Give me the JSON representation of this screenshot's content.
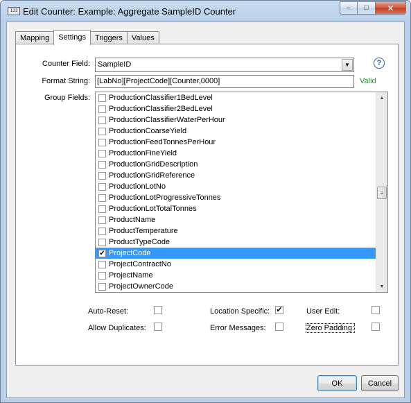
{
  "window": {
    "icon_text": "123",
    "title": "Edit Counter: Example: Aggregate SampleID Counter",
    "controls": {
      "minimize": "–",
      "maximize": "□",
      "close": "✕"
    }
  },
  "tabs": [
    {
      "label": "Mapping"
    },
    {
      "label": "Settings"
    },
    {
      "label": "Triggers"
    },
    {
      "label": "Values"
    }
  ],
  "form": {
    "counter_field_label": "Counter Field:",
    "counter_field_value": "SampleID",
    "help_glyph": "?",
    "format_string_label": "Format String:",
    "format_string_value": "[LabNo][ProjectCode][Counter,0000]",
    "valid_text": "Valid",
    "group_fields_label": "Group Fields:"
  },
  "group_fields": [
    {
      "label": "ProductionClassifier1BedLevel",
      "mark": ""
    },
    {
      "label": "ProductionClassifier2BedLevel",
      "mark": ""
    },
    {
      "label": "ProductionClassifierWaterPerHour",
      "mark": ""
    },
    {
      "label": "ProductionCoarseYield",
      "mark": ""
    },
    {
      "label": "ProductionFeedTonnesPerHour",
      "mark": ""
    },
    {
      "label": "ProductionFineYield",
      "mark": ""
    },
    {
      "label": "ProductionGridDescription",
      "mark": ""
    },
    {
      "label": "ProductionGridReference",
      "mark": ""
    },
    {
      "label": "ProductionLotNo",
      "mark": ""
    },
    {
      "label": "ProductionLotProgressiveTonnes",
      "mark": ""
    },
    {
      "label": "ProductionLotTotalTonnes",
      "mark": ""
    },
    {
      "label": "ProductName",
      "mark": ""
    },
    {
      "label": "ProductTemperature",
      "mark": ""
    },
    {
      "label": "ProductTypeCode",
      "mark": ""
    },
    {
      "label": "ProjectCode",
      "mark": "✔"
    },
    {
      "label": "ProjectContractNo",
      "mark": ""
    },
    {
      "label": "ProjectName",
      "mark": ""
    },
    {
      "label": "ProjectOwnerCode",
      "mark": ""
    }
  ],
  "options": {
    "auto_reset": {
      "label": "Auto-Reset:",
      "mark": ""
    },
    "allow_duplicates": {
      "label": "Allow Duplicates:",
      "mark": ""
    },
    "location_specific": {
      "label": "Location Specific:",
      "mark": "✔"
    },
    "error_messages": {
      "label": "Error Messages:",
      "mark": ""
    },
    "user_edit": {
      "label": "User Edit:",
      "mark": ""
    },
    "zero_padding": {
      "label": "Zero Padding:",
      "mark": ""
    }
  },
  "buttons": {
    "ok": "OK",
    "cancel": "Cancel"
  },
  "colors": {
    "selection": "#3399ff",
    "valid": "#1c9a1c",
    "help": "#2a5db0"
  }
}
